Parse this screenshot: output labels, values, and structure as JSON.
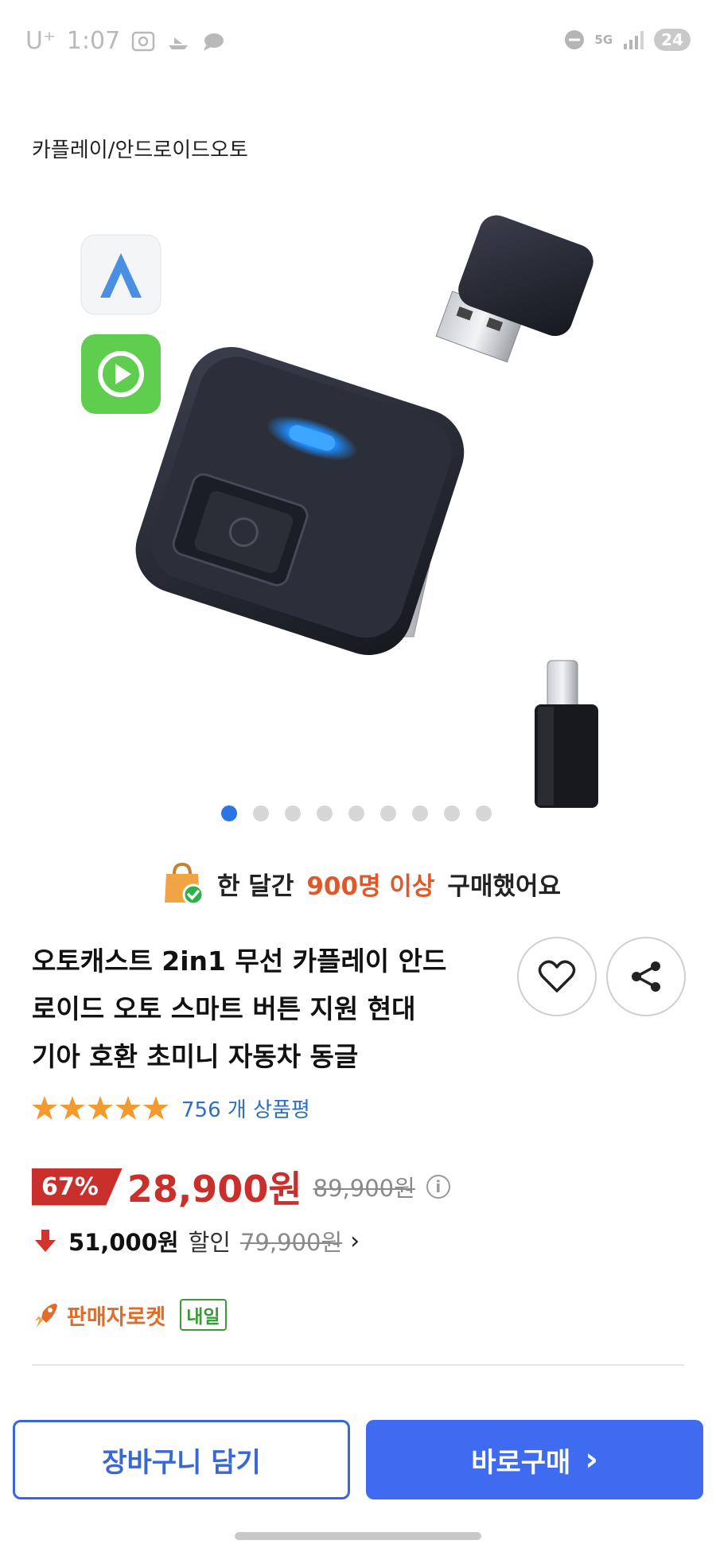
{
  "status_bar": {
    "carrier": "U⁺",
    "time": "1:07",
    "network": "5G",
    "battery": "24"
  },
  "category": "카플레이/안드로이드오토",
  "carousel": {
    "total": 9,
    "active_index": 0
  },
  "purchase_info": {
    "prefix": "한 달간",
    "highlight": "900명 이상",
    "suffix": "구매했어요"
  },
  "product": {
    "title_lines": [
      "오토캐스트 2in1 무선 카플레이 안드",
      "로이드 오토 스마트 버튼 지원 현대",
      "기아 호환 초미니 자동차 동글"
    ],
    "rating_stars": 5,
    "review_count": "756 개 상품평"
  },
  "price": {
    "discount_percent": "67%",
    "sale_price": "28,900원",
    "original_price": "89,900원",
    "info_symbol": "i"
  },
  "coupon": {
    "discount_amount": "51,000원",
    "label": "할인",
    "compare_price": "79,900원",
    "chevron": "›"
  },
  "delivery": {
    "label": "판매자로켓",
    "tag": "내일"
  },
  "actions": {
    "cart_label": "장바구니 담기",
    "buy_label": "바로구매",
    "buy_chevron": "›"
  },
  "colors": {
    "accent_blue": "#3e6bef",
    "price_red": "#c9302c",
    "highlight_orange": "#e0582a",
    "star": "#f29a2e",
    "review_link": "#2e6fc6"
  },
  "icons": {
    "wishlist": "heart-icon",
    "share": "share-icon",
    "purchase_bag": "shopping-bag-check-icon",
    "coupon_arrow": "down-arrow-icon",
    "rocket": "rocket-icon"
  }
}
